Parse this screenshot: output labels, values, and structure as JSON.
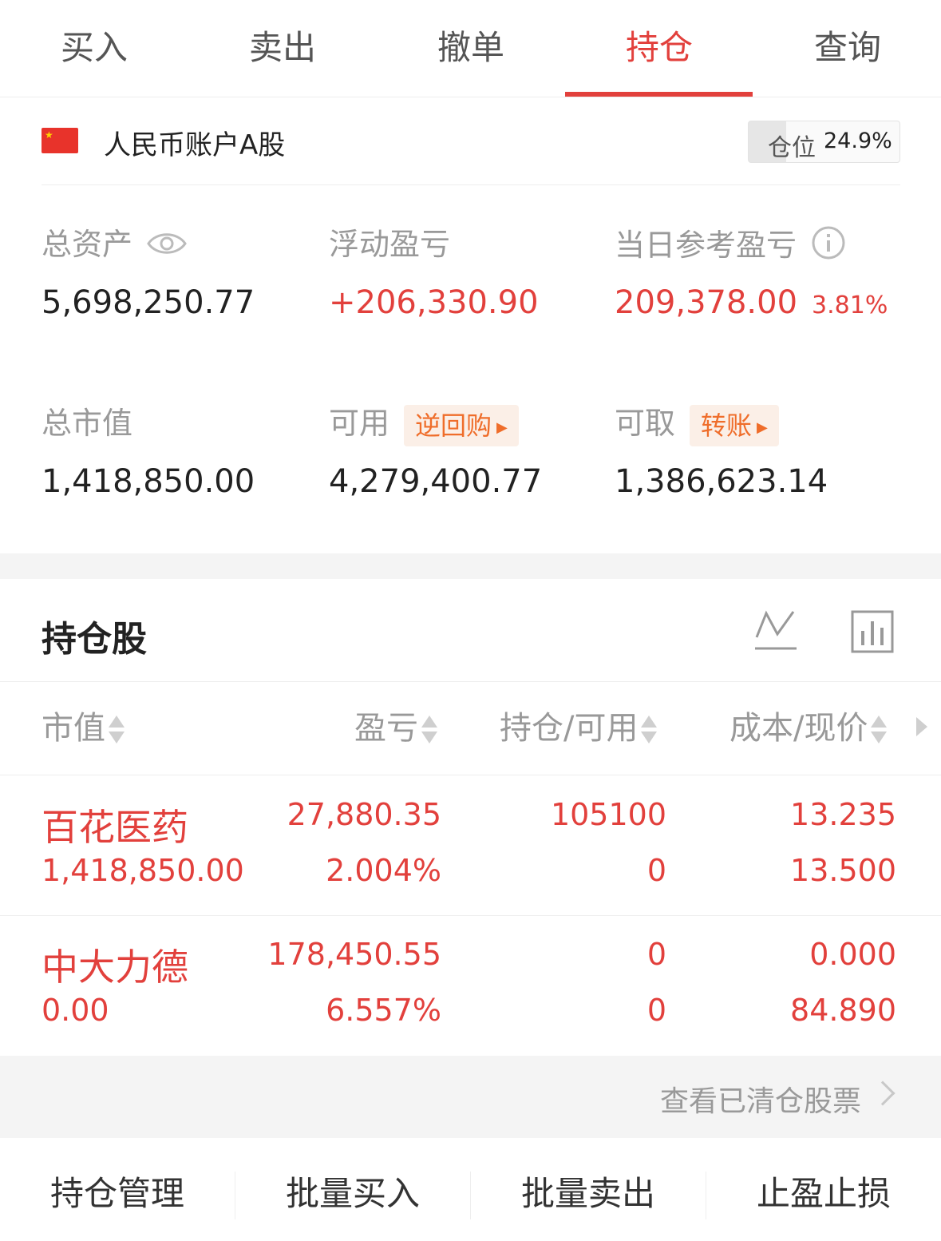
{
  "tabs": [
    {
      "label": "买入"
    },
    {
      "label": "卖出"
    },
    {
      "label": "撤单"
    },
    {
      "label": "持仓"
    },
    {
      "label": "查询"
    }
  ],
  "active_tab": "持仓",
  "account": {
    "name": "人民币账户A股",
    "flag_icon": "china-flag-icon",
    "position_label": "仓位",
    "position_value": "24.9%",
    "position_fraction": 0.249
  },
  "stats": {
    "total_assets": {
      "label": "总资产",
      "value": "5,698,250.77",
      "icon": "eye-icon"
    },
    "floating_pnl": {
      "label": "浮动盈亏",
      "value": "+206,330.90"
    },
    "daily_pnl": {
      "label": "当日参考盈亏",
      "value": "209,378.00",
      "pct": "3.81%",
      "icon": "info-icon"
    },
    "market_value": {
      "label": "总市值",
      "value": "1,418,850.00"
    },
    "available": {
      "label": "可用",
      "value": "4,279,400.77",
      "tag": "逆回购"
    },
    "withdrawable": {
      "label": "可取",
      "value": "1,386,623.14",
      "tag": "转账"
    }
  },
  "holdings": {
    "title": "持仓股",
    "columns": [
      "市值",
      "盈亏",
      "持仓/可用",
      "成本/现价"
    ],
    "rows": [
      {
        "name": "百花医药",
        "market_value": "1,418,850.00",
        "pnl": "27,880.35",
        "pnl_pct": "2.004%",
        "position": "105100",
        "available": "0",
        "cost": "13.235",
        "price": "13.500"
      },
      {
        "name": "中大力德",
        "market_value": "0.00",
        "pnl": "178,450.55",
        "pnl_pct": "6.557%",
        "position": "0",
        "available": "0",
        "cost": "0.000",
        "price": "84.890"
      }
    ],
    "cleared_link": "查看已清仓股票"
  },
  "bottom_actions": [
    "持仓管理",
    "批量买入",
    "批量卖出",
    "止盈止损"
  ],
  "colors": {
    "accent": "#e2403c",
    "tag_text": "#ef6d2a",
    "tag_bg": "#fbefe7",
    "muted": "#999999"
  }
}
